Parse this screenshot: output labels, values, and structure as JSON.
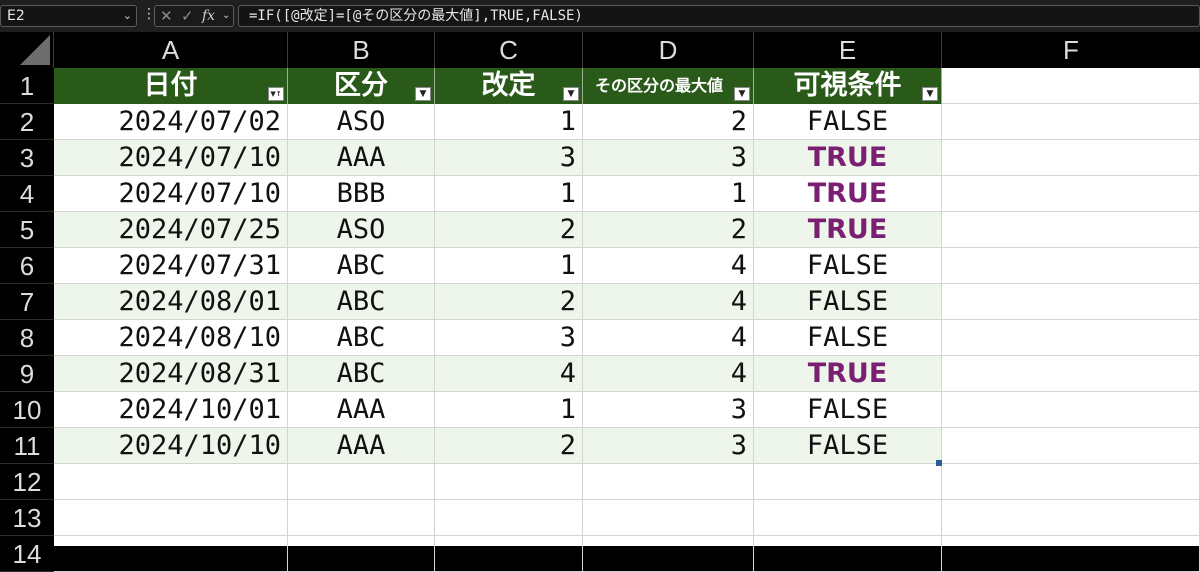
{
  "namebox": {
    "value": "E2"
  },
  "formula_bar": {
    "icons": [
      "more-dots-icon",
      "cancel-icon",
      "enter-icon",
      "fx-icon",
      "chevron-down-icon"
    ],
    "formula": "=IF([@改定]=[@その区分の最大値],TRUE,FALSE)"
  },
  "columns": [
    "A",
    "B",
    "C",
    "D",
    "E",
    "F"
  ],
  "rows": [
    "1",
    "2",
    "3",
    "4",
    "5",
    "6",
    "7",
    "8",
    "9",
    "10",
    "11",
    "12",
    "13",
    "14"
  ],
  "table": {
    "headers": [
      "日付",
      "区分",
      "改定",
      "その区分の最大値",
      "可視条件"
    ],
    "rows": [
      [
        "2024/07/02",
        "ASO",
        "1",
        "2",
        "FALSE"
      ],
      [
        "2024/07/10",
        "AAA",
        "3",
        "3",
        "TRUE"
      ],
      [
        "2024/07/10",
        "BBB",
        "1",
        "1",
        "TRUE"
      ],
      [
        "2024/07/25",
        "ASO",
        "2",
        "2",
        "TRUE"
      ],
      [
        "2024/07/31",
        "ABC",
        "1",
        "4",
        "FALSE"
      ],
      [
        "2024/08/01",
        "ABC",
        "2",
        "4",
        "FALSE"
      ],
      [
        "2024/08/10",
        "ABC",
        "3",
        "4",
        "FALSE"
      ],
      [
        "2024/08/31",
        "ABC",
        "4",
        "4",
        "TRUE"
      ],
      [
        "2024/10/01",
        "AAA",
        "1",
        "3",
        "FALSE"
      ],
      [
        "2024/10/10",
        "AAA",
        "2",
        "3",
        "FALSE"
      ]
    ]
  },
  "colors": {
    "header_bg": "#2a5a1a",
    "band": "#eef5ea",
    "true_text": "#7a1f72"
  }
}
